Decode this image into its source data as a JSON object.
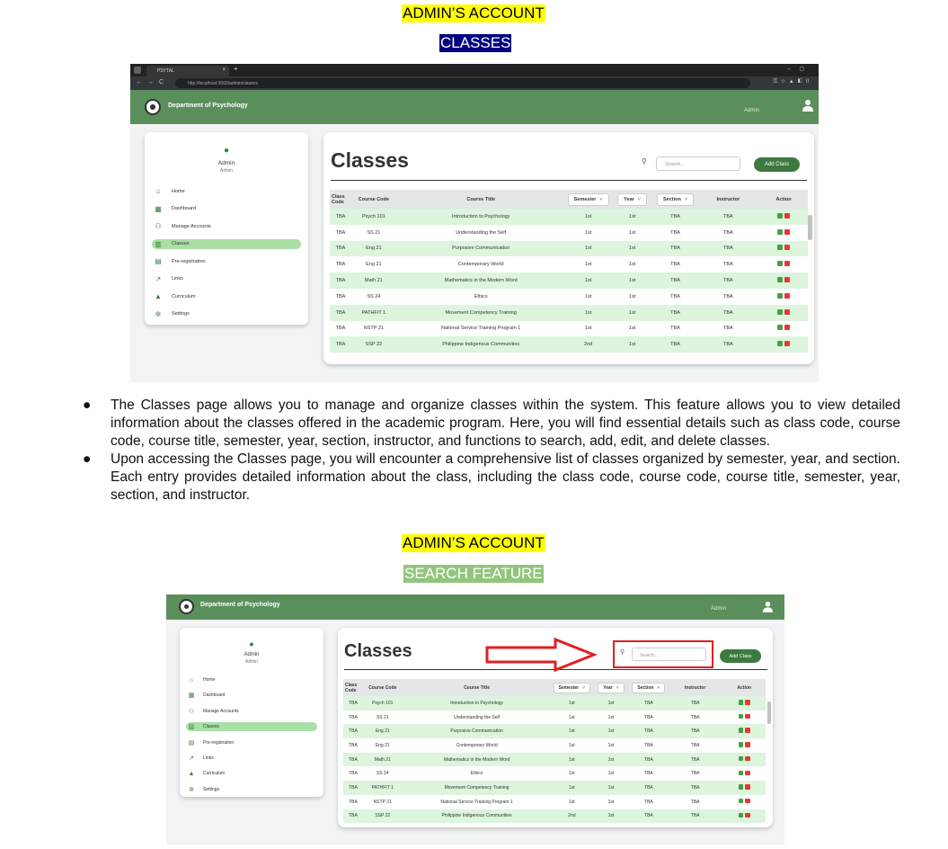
{
  "heading1": {
    "account": "ADMIN’S ACCOUNT",
    "section": "CLASSES"
  },
  "heading2": {
    "account": "ADMIN’S ACCOUNT",
    "section": "SEARCH FEATURE"
  },
  "browser": {
    "tab_title": "PSYTAL",
    "tab_close": "×",
    "new_tab": "+",
    "url": "http://localhost:3000/admin/classes",
    "nav_glyphs": "←→C",
    "window_controls": "–▢",
    "ext_glyphs": "⚿☆▲◧▯"
  },
  "app": {
    "department": "Department of Psychology",
    "admin_label": "Admin",
    "sidebar": {
      "name": "Admin",
      "role": "Admin",
      "items": [
        {
          "label": "Home",
          "icon": "home-icon",
          "glyph": "⌂"
        },
        {
          "label": "Dashboard",
          "icon": "dashboard-icon",
          "glyph": "▦"
        },
        {
          "label": "Manage Accounts",
          "icon": "users-icon",
          "glyph": "⚇"
        },
        {
          "label": "Classes",
          "icon": "book-icon",
          "glyph": "▥"
        },
        {
          "label": "Pre-registration",
          "icon": "document-icon",
          "glyph": "▤"
        },
        {
          "label": "Links",
          "icon": "external-link-icon",
          "glyph": "↗"
        },
        {
          "label": "Curriculum",
          "icon": "graduation-cap-icon",
          "glyph": "▲"
        },
        {
          "label": "Settings",
          "icon": "gear-icon",
          "glyph": "✲"
        }
      ],
      "active_index": 3
    },
    "page_title": "Classes",
    "search_placeholder": "Search...",
    "add_button": "Add Class",
    "columns": {
      "class_code": "Class Code",
      "course_code": "Course Code",
      "course_title": "Course Title",
      "semester": "Semester",
      "year": "Year",
      "section": "Section",
      "instructor": "Instructor",
      "action": "Action"
    },
    "rows": [
      [
        "TBA",
        "Psych 101",
        "Introduction to Psychology",
        "1st",
        "1st",
        "TBA",
        "TBA"
      ],
      [
        "TBA",
        "SS 21",
        "Understanding the Self",
        "1st",
        "1st",
        "TBA",
        "TBA"
      ],
      [
        "TBA",
        "Eng 21",
        "Purposive Communication",
        "1st",
        "1st",
        "TBA",
        "TBA"
      ],
      [
        "TBA",
        "Eng 21",
        "Contemporary World",
        "1st",
        "1st",
        "TBA",
        "TBA"
      ],
      [
        "TBA",
        "Math 21",
        "Mathematics in the Modern Word",
        "1st",
        "1st",
        "TBA",
        "TBA"
      ],
      [
        "TBA",
        "SS 24",
        "Ethics",
        "1st",
        "1st",
        "TBA",
        "TBA"
      ],
      [
        "TBA",
        "PATHFIT 1",
        "Movement Competency Training",
        "1st",
        "1st",
        "TBA",
        "TBA"
      ],
      [
        "TBA",
        "NSTP 21",
        "National Service Training Program 1",
        "1st",
        "1st",
        "TBA",
        "TBA"
      ],
      [
        "TBA",
        "SSP 22",
        "Philippine Indigenous Communities",
        "2nd",
        "1st",
        "TBA",
        "TBA"
      ]
    ]
  },
  "paragraphs": [
    "The Classes page allows you to manage and organize classes within the system. This feature allows you to view detailed information about the classes offered in the academic program. Here, you will find essential details such as class code, course code, course title, semester, year, section, instructor, and functions to search, add, edit, and delete classes.",
    "Upon accessing the Classes page, you will encounter a comprehensive list of classes organized by semester, year, and section. Each entry provides detailed information about the class, including the class code, course code, course title, semester, year, section, and instructor."
  ],
  "colors": {
    "appbar": "#5a8f5c",
    "accent": "#3d7a3f",
    "row_alt": "#dcf5dc",
    "active_nav": "#a9e0a5",
    "annotation": "#e02020"
  }
}
